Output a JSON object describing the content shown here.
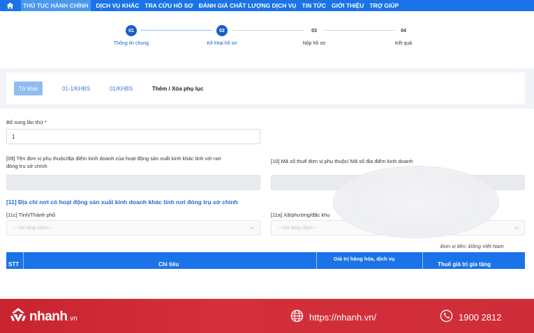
{
  "nav": {
    "items": [
      "THỦ TỤC HÀNH CHÍNH",
      "DỊCH VỤ KHÁC",
      "TRA CỨU HỒ SƠ",
      "ĐÁNH GIÁ CHẤT LƯỢNG DỊCH VỤ",
      "TIN TỨC",
      "GIỚI THIỆU",
      "TRỢ GIÚP"
    ],
    "active_index": 0,
    "colors": {
      "bar": "#1a73e8"
    }
  },
  "stepper": {
    "steps": [
      {
        "num": "01",
        "label": "Thông tin chung",
        "done": true
      },
      {
        "num": "02",
        "label": "Kê khai hồ sơ",
        "done": true
      },
      {
        "num": "03",
        "label": "Nộp hồ sơ",
        "done": false
      },
      {
        "num": "04",
        "label": "Kết quả",
        "done": false
      }
    ]
  },
  "tabs": [
    {
      "label": "Tờ khai",
      "active": true
    },
    {
      "label": "01-1/KHBS",
      "active": false
    },
    {
      "label": "01/KHBS",
      "active": false
    },
    {
      "label": "Thêm / Xóa phụ lục",
      "active": false
    }
  ],
  "form": {
    "bo_sung_label": "Bổ sung lần thứ *",
    "bo_sung_value": "1",
    "field09_label_line1": "[09] Tên đơn vị phụ thuộc/địa điểm kinh doanh của hoạt động sản xuất kinh khác tỉnh với nơi",
    "field09_label_line2": "đóng trụ sở chính",
    "field10_label": "[10] Mã số thuế đơn vị phụ thuộc/ Mã số địa điểm kinh doanh",
    "section11_title": "[11] Địa chỉ nơi có hoạt động sản xuất kinh doanh khác tỉnh nơi đóng trụ sở chính",
    "field11c_label": "[11c] Tỉnh/Thành phố",
    "field11c_placeholder": "---Vui lòng chọn---",
    "field11a_label": "[11a] Xã/phường/đặc khu",
    "field11a_placeholder": "---Vui lòng chọn---",
    "currency_note": "Đơn vị tiền: Đồng Việt Nam"
  },
  "table": {
    "headers": {
      "stt": "STT",
      "chi_tieu": "Chỉ tiêu",
      "gia_tri": "Giá trị hàng hóa, dịch vụ",
      "thue": "Thuế giá trị gia tăng"
    }
  },
  "footer": {
    "brand": "nhanh",
    "brand_tld": ".vn",
    "url": "https://nhanh.vn/",
    "phone": "1900 2812",
    "icons": {
      "logo": "nhanh-logo-icon",
      "globe": "globe-icon",
      "phone": "phone-icon"
    },
    "colors": {
      "bg": "#c8232e"
    }
  }
}
